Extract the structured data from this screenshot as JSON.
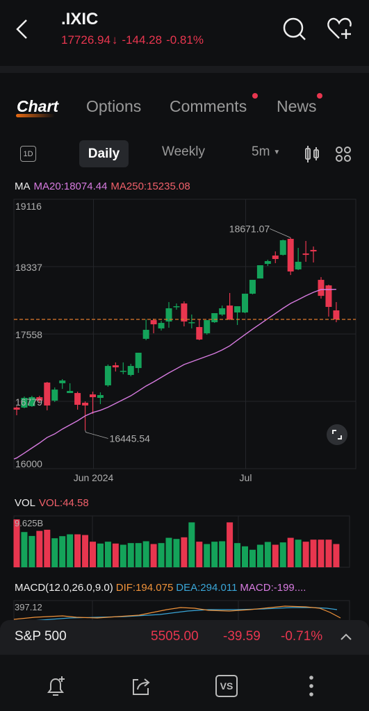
{
  "header": {
    "symbol": ".IXIC",
    "price": "17726.94",
    "arrow": "↓",
    "change": "-144.28",
    "change_pct": "-0.81%",
    "down_color": "#e8364f"
  },
  "tabs": [
    {
      "label": "Chart",
      "active": true
    },
    {
      "label": "Options",
      "badge": true
    },
    {
      "label": "Comments",
      "badge": true
    },
    {
      "label": "News",
      "badge": true
    }
  ],
  "toolbar": {
    "intraday_icon_label": "1D",
    "daily": "Daily",
    "weekly": "Weekly",
    "interval": "5m"
  },
  "ma_legend": {
    "label": "MA",
    "ma20": "MA20:18074.44",
    "ma250": "MA250:15235.08"
  },
  "vol_legend": {
    "label": "VOL",
    "value": "VOL:44.58",
    "max": "9.625B"
  },
  "macd_legend": {
    "label": "MACD(12.0,26.0,9.0)",
    "dif": "DIF:194.075",
    "dea": "DEA:294.011",
    "macd": "MACD:-199....",
    "max": "397.12"
  },
  "colors": {
    "up": "#14a35a",
    "down": "#e8364f",
    "ma20": "#d77be0",
    "last_price_line": "#e0792c",
    "dif": "#f0923a",
    "dea": "#3aa6d8"
  },
  "chart_data": {
    "type": "candlestick",
    "ylim": [
      16000,
      19116
    ],
    "y_ticks": [
      "19116",
      "18337",
      "17558",
      "16779",
      "16000"
    ],
    "x_ticks": [
      {
        "label": "Jun 2024",
        "index": 10
      },
      {
        "label": "Jul",
        "index": 30
      }
    ],
    "high_annotation": {
      "label": "18671.07",
      "index": 36
    },
    "low_annotation": {
      "label": "16445.54",
      "index": 9
    },
    "last_price": 17726.94,
    "candles": [
      [
        16707,
        16723,
        16618,
        16683
      ],
      [
        16707,
        16835,
        16699,
        16819
      ],
      [
        16723,
        16843,
        16715,
        16827
      ],
      [
        16827,
        16843,
        16763,
        16787
      ],
      [
        16996,
        17004,
        16675,
        16731
      ],
      [
        16787,
        16940,
        16771,
        16915
      ],
      [
        16988,
        17036,
        16923,
        17020
      ],
      [
        16875,
        16988,
        16875,
        16899
      ],
      [
        16875,
        16891,
        16683,
        16739
      ],
      [
        16763,
        16779,
        16445.54,
        16731
      ],
      [
        16859,
        16891,
        16634,
        16827
      ],
      [
        16819,
        16883,
        16747,
        16851
      ],
      [
        16964,
        17205,
        16948,
        17188
      ],
      [
        17196,
        17229,
        17124,
        17172
      ],
      [
        17124,
        17229,
        17092,
        17132
      ],
      [
        17084,
        17213,
        17068,
        17188
      ],
      [
        17164,
        17341,
        17108,
        17341
      ],
      [
        17502,
        17727,
        17486,
        17606
      ],
      [
        17718,
        17735,
        17566,
        17670
      ],
      [
        17622,
        17710,
        17598,
        17686
      ],
      [
        17702,
        17927,
        17630,
        17855
      ],
      [
        17871,
        17911,
        17839,
        17879
      ],
      [
        17911,
        17935,
        17646,
        17702
      ],
      [
        17686,
        17783,
        17622,
        17694
      ],
      [
        17638,
        17727,
        17486,
        17494
      ],
      [
        17566,
        17718,
        17550,
        17718
      ],
      [
        17694,
        17799,
        17686,
        17799
      ],
      [
        17783,
        17887,
        17767,
        17855
      ],
      [
        17887,
        18032,
        17718,
        17727
      ],
      [
        17807,
        17879,
        17662,
        17879
      ],
      [
        17807,
        18024,
        17799,
        18024
      ],
      [
        18024,
        18184,
        18016,
        18184
      ],
      [
        18200,
        18353,
        18200,
        18353
      ],
      [
        18369,
        18417,
        18345,
        18401
      ],
      [
        18465,
        18513,
        18377,
        18425
      ],
      [
        18473,
        18650,
        18465,
        18642
      ],
      [
        18658,
        18671.07,
        18240,
        18281
      ],
      [
        18305,
        18554,
        18297,
        18393
      ],
      [
        18489,
        18634,
        18393,
        18473
      ],
      [
        18530,
        18570,
        18385,
        18513
      ],
      [
        18184,
        18216,
        17967,
        17999
      ],
      [
        18120,
        18128,
        17759,
        17871
      ],
      [
        17831,
        17927,
        17694,
        17726.94
      ]
    ],
    "ma20": [
      16124,
      16180,
      16239,
      16297,
      16361,
      16402,
      16458,
      16506,
      16554,
      16610,
      16650,
      16675,
      16711,
      16755,
      16799,
      16843,
      16899,
      16956,
      17004,
      17056,
      17108,
      17156,
      17205,
      17237,
      17269,
      17301,
      17333,
      17373,
      17421,
      17486,
      17550,
      17614,
      17674,
      17735,
      17795,
      17855,
      17911,
      17955,
      18000,
      18040,
      18072,
      18072,
      18074.44
    ],
    "volume_billions": [
      9.625,
      7.08,
      6.29,
      7.31,
      7.54,
      5.83,
      6.25,
      6.62,
      6.62,
      6.48,
      5.14,
      4.77,
      5.14,
      4.77,
      4.53,
      4.86,
      4.86,
      5.23,
      4.67,
      4.86,
      5.92,
      5.69,
      6.02,
      9.02,
      5.14,
      4.67,
      5.14,
      5.23,
      9.02,
      4.86,
      4.21,
      3.52,
      4.53,
      5.09,
      4.53,
      5.0,
      5.92,
      5.55,
      5.14,
      5.55,
      5.55,
      5.55,
      4.67
    ]
  },
  "sp500": {
    "name": "S&P 500",
    "price": "5505.00",
    "change": "-39.59",
    "change_pct": "-0.71%"
  },
  "bottom_nav": [
    {
      "icon": "bell-plus-icon"
    },
    {
      "icon": "share-icon"
    },
    {
      "icon": "vs-icon",
      "label": "VS"
    },
    {
      "icon": "more-vertical-icon"
    }
  ]
}
